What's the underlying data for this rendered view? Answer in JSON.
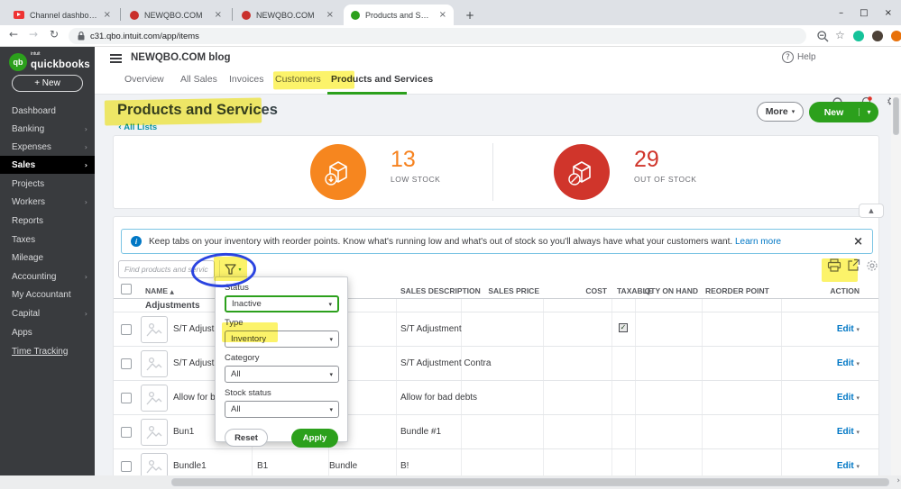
{
  "browser": {
    "tabs": [
      {
        "title": "Channel dashboard - YouTube S",
        "icon": "youtube"
      },
      {
        "title": "NEWQBO.COM",
        "icon": "site-red"
      },
      {
        "title": "NEWQBO.COM",
        "icon": "site-red"
      },
      {
        "title": "Products and Services",
        "icon": "site-green"
      }
    ],
    "url": "c31.qbo.intuit.com/app/items"
  },
  "icons": {
    "close": "×",
    "new_tab": "+",
    "minimize": "–",
    "maximize": "□",
    "back": "←",
    "forward": "→",
    "reload": "↻",
    "star": "☆",
    "gear": "⚙",
    "help": "?",
    "chevron_down": "▾",
    "chevron_up": "▲",
    "sort_asc": "▲",
    "back_chevron": "‹",
    "forward_chevron": "›",
    "check": "✓",
    "info": "i"
  },
  "app_header": {
    "company": "NEWQBO.COM blog",
    "help_label": "Help"
  },
  "nav_tabs": [
    {
      "label": "Overview"
    },
    {
      "label": "All Sales"
    },
    {
      "label": "Invoices"
    },
    {
      "label": "Customers"
    },
    {
      "label": "Products and Services",
      "active": true
    }
  ],
  "sidebar": {
    "logo_top": "intuit",
    "logo_text": "quickbooks",
    "logo_badge": "qb",
    "new_button": "+  New",
    "items": [
      {
        "label": "Dashboard",
        "expand": false
      },
      {
        "label": "Banking",
        "expand": true
      },
      {
        "label": "Expenses",
        "expand": true
      },
      {
        "label": "Sales",
        "expand": true,
        "active": true
      },
      {
        "label": "Projects",
        "expand": false
      },
      {
        "label": "Workers",
        "expand": true
      },
      {
        "label": "Reports",
        "expand": false
      },
      {
        "label": "Taxes",
        "expand": false
      },
      {
        "label": "Mileage",
        "expand": false
      },
      {
        "label": "Accounting",
        "expand": true
      },
      {
        "label": "My Accountant",
        "expand": false
      },
      {
        "label": "Capital",
        "expand": true
      },
      {
        "label": "Apps",
        "expand": false
      },
      {
        "label": "Time Tracking",
        "expand": false
      }
    ]
  },
  "page": {
    "title": "Products and Services",
    "back_link": "All Lists",
    "more_button": "More",
    "new_button": "New"
  },
  "stats": {
    "low_stock_value": "13",
    "low_stock_label": "LOW STOCK",
    "out_of_stock_value": "29",
    "out_of_stock_label": "OUT OF STOCK",
    "low_color": "#f6821f",
    "out_color": "#d0352b"
  },
  "banner": {
    "message": "Keep tabs on your inventory with reorder points. Know what's running low and what's out of stock so you'll always have what your customers want.",
    "link": "Learn more"
  },
  "toolbar": {
    "search_placeholder": "Find products and services"
  },
  "filter": {
    "status_label": "Status",
    "status_value": "Inactive",
    "type_label": "Type",
    "type_value": "Inventory",
    "category_label": "Category",
    "category_value": "All",
    "stock_label": "Stock status",
    "stock_value": "All",
    "reset_label": "Reset",
    "apply_label": "Apply"
  },
  "table": {
    "headers": {
      "name": "NAME",
      "desc": "SALES DESCRIPTION",
      "price": "SALES PRICE",
      "cost": "COST",
      "taxable": "TAXABLE",
      "qty": "QTY ON HAND",
      "reorder": "REORDER POINT",
      "action": "ACTION"
    },
    "group_label": "Adjustments",
    "rows": [
      {
        "name": "S/T Adjustment",
        "sku": "",
        "type": "",
        "desc": "S/T Adjustment",
        "taxable": true,
        "action": "Edit"
      },
      {
        "name": "S/T Adjustment",
        "sku": "",
        "type": "",
        "desc": "S/T Adjustment Contra",
        "taxable": false,
        "action": "Edit"
      },
      {
        "name": "Allow for bad d",
        "sku": "",
        "type": "",
        "desc": "Allow for bad debts",
        "taxable": false,
        "action": "Edit"
      },
      {
        "name": "Bun1",
        "sku": "",
        "type": "",
        "desc": "Bundle #1",
        "taxable": false,
        "action": "Edit"
      },
      {
        "name": "Bundle1",
        "sku": "B1",
        "type": "Bundle",
        "desc": "B!",
        "taxable": false,
        "action": "Edit"
      }
    ]
  }
}
